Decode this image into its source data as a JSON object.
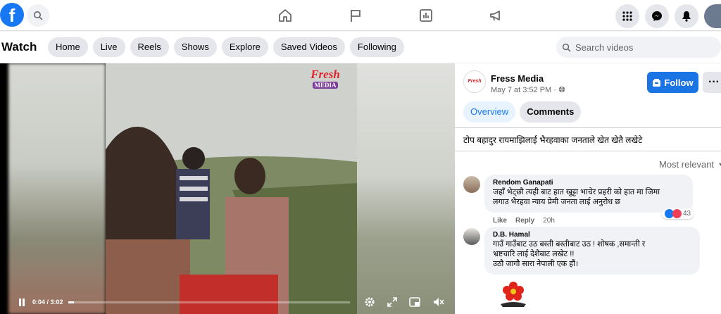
{
  "nav": {
    "logo": "f"
  },
  "watch": {
    "title": "Watch",
    "pills": [
      "Home",
      "Live",
      "Reels",
      "Shows",
      "Explore",
      "Saved Videos",
      "Following"
    ],
    "search_placeholder": "Search videos"
  },
  "video": {
    "watermark": "Fresh",
    "watermark_sub": "MEDIA",
    "time": "0:04 / 3:02",
    "progress_fraction": 0.02
  },
  "post": {
    "page_name": "Fress Media",
    "page_avatar_text": "Fresh",
    "meta": "May 7 at 3:52 PM · ",
    "follow_label": "Follow",
    "more_label": "···",
    "tabs": [
      "Overview",
      "Comments"
    ],
    "caption": "टोप बहादुर रायमाझिलाई भैरहवाका जनताले खेत खेतै लखेटे",
    "sort_label": "Most relevant"
  },
  "comments": [
    {
      "author": "Rendom Ganapati",
      "lines": [
        "जहाँ भेट्छौ त्यही बाट हात खुट्टा भाचेर प्रहरी को हात मा जिमा",
        "लगाउ भैरहवा न्याय प्रेमी जनता लाई अनुरोध छ"
      ],
      "like": "Like",
      "reply": "Reply",
      "time": "20h",
      "reaction_count": "43"
    },
    {
      "author": "D.B. Hamal",
      "lines": [
        "गाउँ गाउँबाट उठ बस्ती बस्तीबाट उठ ! शोषक ,समान्ती र",
        "भ्रष्टचारि लाई देशैबाट लखेट !!",
        "उठौ जागौ सारा नेपाली एक हौं।"
      ]
    }
  ],
  "colors": {
    "brand": "#1877f2",
    "follow": "#1b74e4"
  }
}
